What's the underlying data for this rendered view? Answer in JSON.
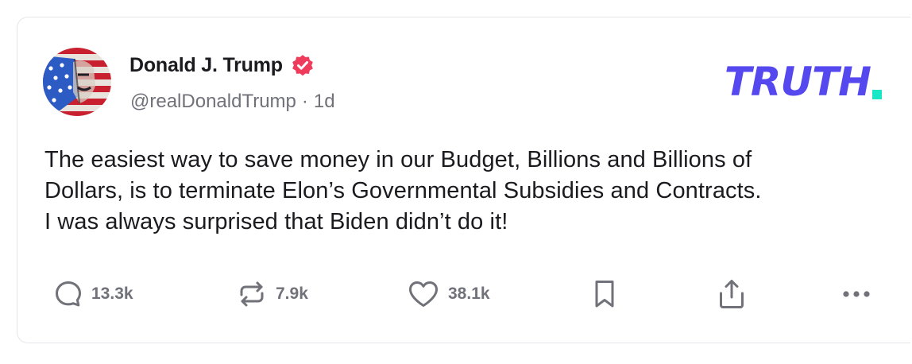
{
  "post": {
    "author": {
      "display_name": "Donald J. Trump",
      "handle": "@realDonaldTrump",
      "separator": "·",
      "time_ago": "1d",
      "verified": true
    },
    "brand": {
      "logo_text": "TRUTH",
      "primary_color": "#5448ee",
      "accent_color": "#17e6c7"
    },
    "body_lines": [
      "The easiest way to save money in our Budget, Billions and Billions of",
      "Dollars, is to terminate Elon’s Governmental Subsidies and Contracts.",
      "I was always surprised that Biden didn’t do it!"
    ],
    "actions": {
      "reply": {
        "icon": "reply-icon",
        "count": "13.3k"
      },
      "retruth": {
        "icon": "retruth-icon",
        "count": "7.9k"
      },
      "like": {
        "icon": "heart-icon",
        "count": "38.1k"
      },
      "bookmark": {
        "icon": "bookmark-icon"
      },
      "share": {
        "icon": "share-icon"
      },
      "more": {
        "icon": "more-icon"
      }
    },
    "colors": {
      "text": "#1a1a1f",
      "muted": "#71717a",
      "verified_badge": "#ef3b5c"
    }
  }
}
